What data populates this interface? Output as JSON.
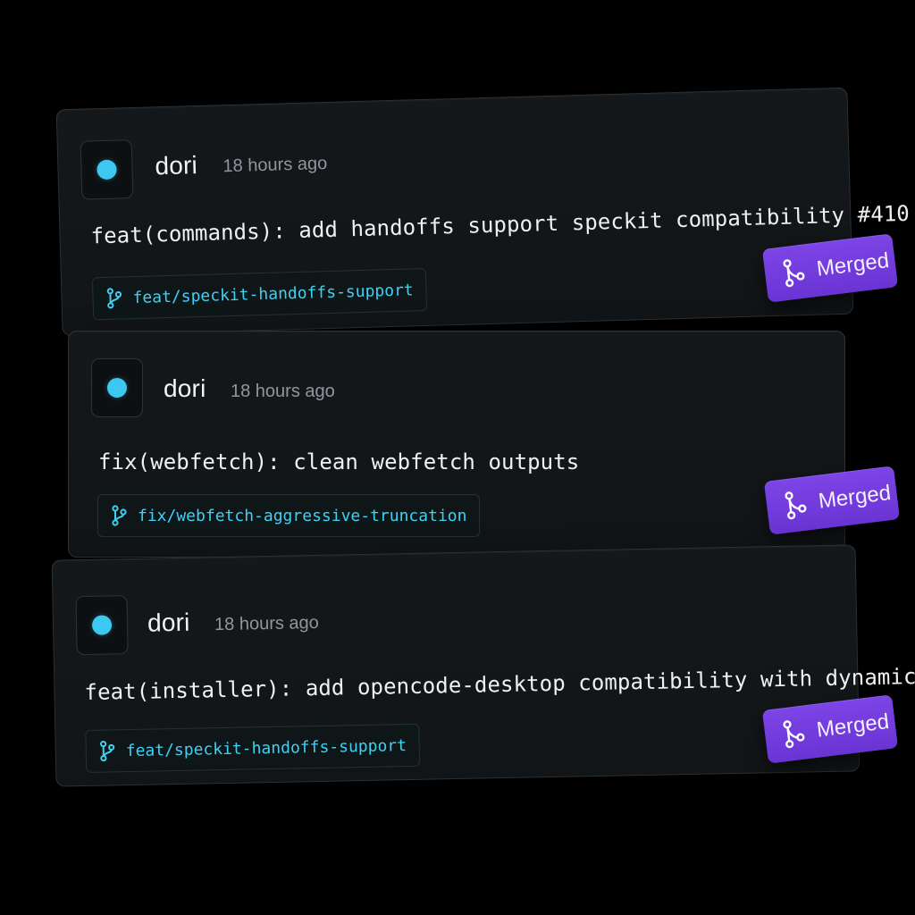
{
  "activity": {
    "items": [
      {
        "author": "dori",
        "time": "18 hours ago",
        "commit_message": "feat(commands): add handoffs support speckit compatibility #410",
        "branch": "feat/speckit-handoffs-support",
        "status": "Merged"
      },
      {
        "author": "dori",
        "time": "18 hours ago",
        "commit_message": "fix(webfetch): clean webfetch outputs",
        "branch": "fix/webfetch-aggressive-truncation",
        "status": "Merged"
      },
      {
        "author": "dori",
        "time": "18 hours ago",
        "commit_message": "feat(installer): add opencode-desktop compatibility with dynamic config",
        "branch": "feat/speckit-handoffs-support",
        "status": "Merged"
      }
    ]
  },
  "icons": {
    "avatar": "avatar-dot-icon",
    "branch": "git-branch-icon",
    "merged": "git-merge-icon"
  },
  "colors": {
    "background": "#000000",
    "card": "#14171a",
    "avatar_dot": "#3cc8f0",
    "branch_text": "#3fd0f2",
    "merged_badge": "#7340dc"
  }
}
